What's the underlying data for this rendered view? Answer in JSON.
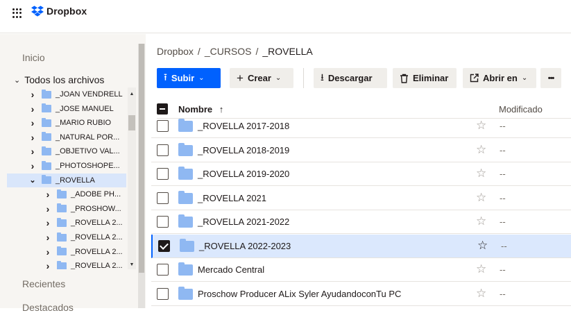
{
  "app": {
    "logo_text": "Dropbox",
    "accent": "#0061fe"
  },
  "sidebar": {
    "home": "Inicio",
    "all_files": "Todos los archivos",
    "recent": "Recientes",
    "starred": "Destacados",
    "tree": [
      {
        "label": "_JOAN VENDRELL",
        "level": 0,
        "expanded": false,
        "selected": false
      },
      {
        "label": "_JOSE MANUEL",
        "level": 0,
        "expanded": false,
        "selected": false
      },
      {
        "label": "_MARIO RUBIO",
        "level": 0,
        "expanded": false,
        "selected": false
      },
      {
        "label": "_NATURAL POR...",
        "level": 0,
        "expanded": false,
        "selected": false
      },
      {
        "label": "_OBJETIVO VAL...",
        "level": 0,
        "expanded": false,
        "selected": false
      },
      {
        "label": "_PHOTOSHOPE...",
        "level": 0,
        "expanded": false,
        "selected": false
      },
      {
        "label": "_ROVELLA",
        "level": 0,
        "expanded": true,
        "selected": true
      },
      {
        "label": "_ADOBE PH...",
        "level": 1,
        "expanded": false,
        "selected": false
      },
      {
        "label": "_PROSHOW...",
        "level": 1,
        "expanded": false,
        "selected": false
      },
      {
        "label": "_ROVELLA 2...",
        "level": 1,
        "expanded": false,
        "selected": false
      },
      {
        "label": "_ROVELLA 2...",
        "level": 1,
        "expanded": false,
        "selected": false
      },
      {
        "label": "_ROVELLA 2...",
        "level": 1,
        "expanded": false,
        "selected": false
      },
      {
        "label": "_ROVELLA 2...",
        "level": 1,
        "expanded": false,
        "selected": false
      }
    ]
  },
  "breadcrumb": [
    "Dropbox",
    "/",
    "_CURSOS",
    "/",
    "_ROVELLA"
  ],
  "toolbar": {
    "upload": "Subir",
    "create": "Crear",
    "download": "Descargar",
    "delete": "Eliminar",
    "open_in": "Abrir en",
    "more": "•••"
  },
  "table": {
    "col_name": "Nombre",
    "sort_icon": "↑",
    "col_modified": "Modificado",
    "rows": [
      {
        "name": "_ROVELLA 2017-2018",
        "modified": "--",
        "checked": false,
        "starred": false
      },
      {
        "name": "_ROVELLA 2018-2019",
        "modified": "--",
        "checked": false,
        "starred": false
      },
      {
        "name": "_ROVELLA 2019-2020",
        "modified": "--",
        "checked": false,
        "starred": false
      },
      {
        "name": "_ROVELLA 2021",
        "modified": "--",
        "checked": false,
        "starred": false
      },
      {
        "name": "_ROVELLA 2021-2022",
        "modified": "--",
        "checked": false,
        "starred": false
      },
      {
        "name": "_ROVELLA 2022-2023",
        "modified": "--",
        "checked": true,
        "starred": false
      },
      {
        "name": "Mercado Central",
        "modified": "--",
        "checked": false,
        "starred": false
      },
      {
        "name": "Proschow Producer ALix Syler AyudandoconTu PC",
        "modified": "--",
        "checked": false,
        "starred": false
      }
    ]
  }
}
